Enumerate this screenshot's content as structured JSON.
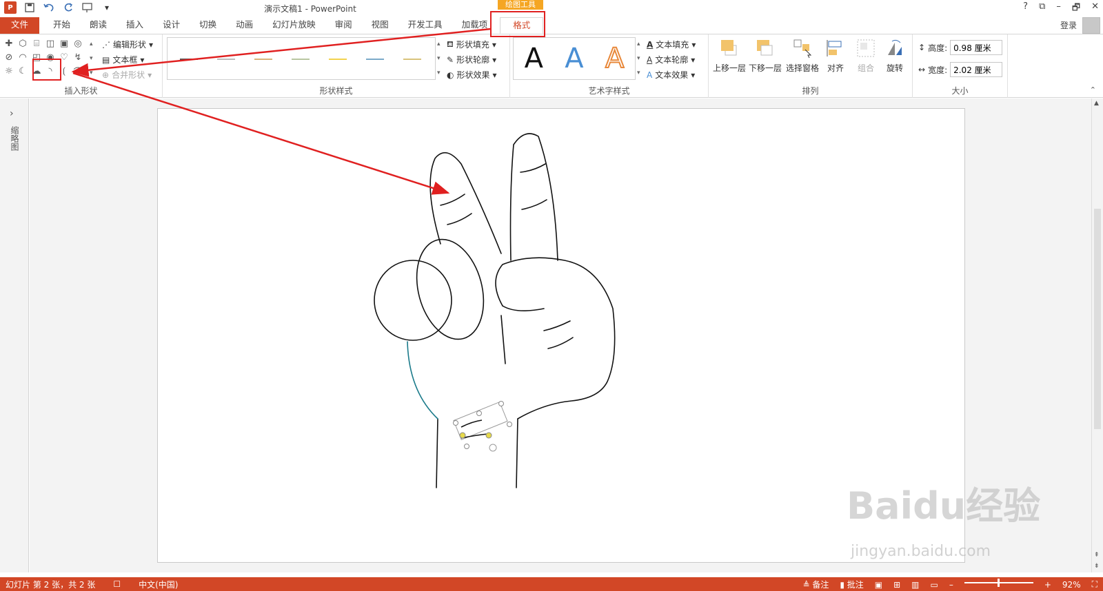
{
  "window": {
    "title": "演示文稿1 - PowerPoint",
    "context_tab_group": "绘图工具",
    "login": "登录",
    "help": "?",
    "minimize": "–",
    "restore": "🗗",
    "close": "✕"
  },
  "tabs": [
    "文件",
    "开始",
    "朗读",
    "插入",
    "设计",
    "切换",
    "动画",
    "幻灯片放映",
    "审阅",
    "视图",
    "开发工具",
    "加载项",
    "格式"
  ],
  "ribbon": {
    "insert_shapes": {
      "label": "插入形状",
      "edit_shape": "编辑形状",
      "text_box": "文本框",
      "merge_shapes": "合并形状"
    },
    "shape_styles": {
      "label": "形状样式",
      "fill": "形状填充",
      "outline": "形状轮廓",
      "effects": "形状效果"
    },
    "wordart_styles": {
      "label": "艺术字样式",
      "sample": "A",
      "text_fill": "文本填充",
      "text_outline": "文本轮廓",
      "text_effects": "文本效果"
    },
    "arrange": {
      "label": "排列",
      "bring_forward": "上移一层",
      "send_backward": "下移一层",
      "selection_pane": "选择窗格",
      "align": "对齐",
      "group": "组合",
      "rotate": "旋转"
    },
    "size": {
      "label": "大小",
      "height_label": "高度:",
      "height_value": "0.98 厘米",
      "width_label": "宽度:",
      "width_value": "2.02 厘米"
    }
  },
  "left_pane": {
    "expand_icon": "›",
    "label": "缩略图"
  },
  "statusbar": {
    "slide_info": "幻灯片 第 2 张，共 2 张",
    "language": "中文(中国)",
    "notes": "备注",
    "comments": "批注",
    "zoom": "92%"
  },
  "watermark": {
    "brand": "Baidu经验",
    "url": "jingyan.baidu.com"
  },
  "colors": {
    "accent": "#d24726",
    "annotation": "#e02020",
    "context_tab": "#f5a623"
  }
}
